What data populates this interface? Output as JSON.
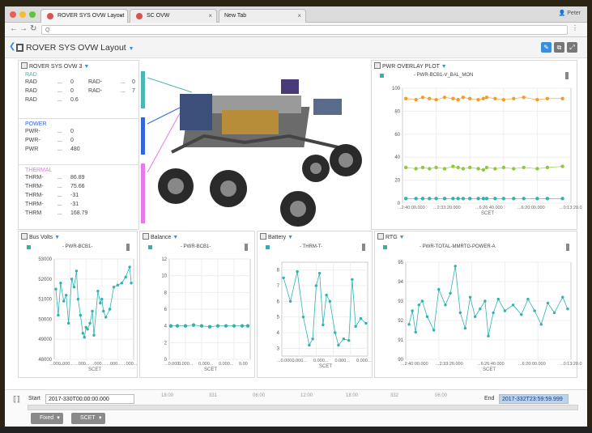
{
  "browser": {
    "tabs": [
      {
        "title": "ROVER SYS OVW Layout",
        "active": true
      },
      {
        "title": "SC OVW",
        "active": false
      },
      {
        "title": "New Tab",
        "active": false
      }
    ],
    "user": "Peter",
    "url": "Q"
  },
  "app": {
    "title": "ROVER SYS OVW Layout"
  },
  "overview_panel": {
    "title": "ROVER SYS OVW 3",
    "sections": [
      {
        "name": "RAD",
        "color": "#4cb7b2",
        "rows": [
          [
            "RAD",
            "...",
            "0",
            "RAD-",
            "...",
            "0"
          ],
          [
            "RAD",
            "...",
            "0",
            "RAD-",
            "...",
            "7"
          ],
          [
            "RAD",
            "...",
            "0.6",
            "",
            "",
            ""
          ]
        ]
      },
      {
        "name": "POWER",
        "color": "#3366dd",
        "rows": [
          [
            "PWR-",
            "...",
            "0"
          ],
          [
            "PWR-",
            "...",
            "0"
          ],
          [
            "PWR",
            "...",
            "480"
          ]
        ]
      },
      {
        "name": "THERMAL",
        "color": "#e879e8",
        "rows": [
          [
            "THRM-",
            "...",
            "86.89"
          ],
          [
            "THRM-",
            "...",
            "75.66"
          ],
          [
            "THRM-",
            "...",
            "-31"
          ],
          [
            "THRM-",
            "...",
            "-31"
          ],
          [
            "THRM",
            "...",
            "168.79"
          ]
        ]
      }
    ]
  },
  "charts": {
    "pwr": {
      "title": "PWR OVERLAY PLOT",
      "legend": "- PWR-BCB1-V_BAL_MON",
      "xlabel": "SCET",
      "xticks": [
        "...2:40:00.000",
        "...2:33:20.000",
        "...6:26:40.000",
        "...6:20:00.000",
        "...0:13:20.0"
      ]
    },
    "bus": {
      "title": "Bus Volts",
      "legend": "- PWR-BCB1-",
      "xlabel": "SCET",
      "xticks": [
        "...000...",
        "...000...",
        "...000...",
        "...000...",
        "...000...",
        "...000..."
      ]
    },
    "balance": {
      "title": "Balance",
      "legend": "- PWR-BCB1-",
      "xlabel": "SCET",
      "xticks": [
        "...0.000...",
        "0.000...",
        "0.000...",
        "0.000...",
        "0.00"
      ]
    },
    "battery": {
      "title": "Battery",
      "legend": "- THRM-T-",
      "xlabel": "SCET",
      "xticks": [
        "...0.000...",
        "0.000...",
        "0.000...",
        "0.000...",
        "0.000..."
      ]
    },
    "rtg": {
      "title": "RTG",
      "legend": "- PWR-TOTAL-MMRTG-POWER-A",
      "xlabel": "SCET",
      "xticks": [
        "...2:40:00.000",
        "...2:33:20.000",
        "...6:26:40.000",
        "...6:20:00.000",
        "...0:13:20.0"
      ]
    }
  },
  "chart_data": [
    {
      "type": "scatter",
      "title": "PWR OVERLAY PLOT",
      "ylim": [
        0,
        100
      ],
      "yticks": [
        0,
        20,
        40,
        60,
        80,
        100
      ],
      "series": [
        {
          "color": "#f39c2b",
          "x": [
            0.02,
            0.08,
            0.12,
            0.16,
            0.2,
            0.25,
            0.3,
            0.33,
            0.36,
            0.4,
            0.45,
            0.48,
            0.5,
            0.55,
            0.6,
            0.66,
            0.72,
            0.8,
            0.86,
            0.95
          ],
          "y": [
            91,
            90,
            92,
            91,
            90,
            92,
            91,
            90,
            92,
            91,
            90,
            91,
            92,
            91,
            90,
            91,
            92,
            90,
            91,
            91
          ]
        },
        {
          "color": "#8fc93a",
          "x": [
            0.02,
            0.08,
            0.12,
            0.16,
            0.2,
            0.25,
            0.3,
            0.33,
            0.36,
            0.4,
            0.45,
            0.48,
            0.5,
            0.55,
            0.6,
            0.66,
            0.72,
            0.8,
            0.86,
            0.95
          ],
          "y": [
            31,
            30,
            31,
            30,
            31,
            30,
            32,
            31,
            30,
            31,
            30,
            29,
            31,
            30,
            31,
            30,
            31,
            30,
            31,
            32
          ]
        },
        {
          "color": "#30b3b0",
          "x": [
            0.02,
            0.08,
            0.12,
            0.16,
            0.2,
            0.25,
            0.3,
            0.33,
            0.36,
            0.4,
            0.45,
            0.48,
            0.5,
            0.55,
            0.6,
            0.66,
            0.72,
            0.8,
            0.86,
            0.95
          ],
          "y": [
            4,
            4,
            4,
            4,
            4,
            4,
            4,
            4,
            4,
            4,
            4,
            4,
            4,
            4,
            4,
            4,
            4,
            4,
            4,
            4
          ]
        }
      ]
    },
    {
      "type": "line",
      "title": "Bus Volts",
      "ylim": [
        48000,
        53000
      ],
      "yticks": [
        48000,
        49000,
        50000,
        51000,
        52000,
        53000
      ],
      "series": [
        {
          "color": "#30b3b0",
          "x": [
            0.02,
            0.05,
            0.08,
            0.12,
            0.15,
            0.18,
            0.22,
            0.25,
            0.28,
            0.3,
            0.33,
            0.36,
            0.38,
            0.4,
            0.42,
            0.45,
            0.48,
            0.5,
            0.55,
            0.58,
            0.6,
            0.62,
            0.65,
            0.7,
            0.75,
            0.8,
            0.85,
            0.9,
            0.95,
            0.97
          ],
          "y": [
            51500,
            50200,
            51800,
            50900,
            51200,
            49800,
            52000,
            51600,
            52400,
            51000,
            50200,
            49300,
            49100,
            49600,
            49500,
            49800,
            50400,
            49200,
            51400,
            50800,
            51000,
            50400,
            50100,
            50500,
            51600,
            51700,
            51800,
            52100,
            52600,
            51800
          ]
        }
      ]
    },
    {
      "type": "line",
      "title": "Balance",
      "ylim": [
        0,
        12
      ],
      "yticks": [
        0,
        2,
        4,
        6,
        8,
        10,
        12
      ],
      "series": [
        {
          "color": "#30b3b0",
          "x": [
            0.02,
            0.1,
            0.2,
            0.3,
            0.4,
            0.5,
            0.6,
            0.7,
            0.8,
            0.9,
            0.97
          ],
          "y": [
            4,
            4,
            4,
            4.1,
            4,
            3.9,
            4,
            4,
            4,
            4,
            4
          ]
        }
      ]
    },
    {
      "type": "line",
      "title": "Battery",
      "ylim": [
        2.5,
        8.5
      ],
      "yticks": [
        3,
        4,
        5,
        6,
        7,
        8
      ],
      "series": [
        {
          "color": "#30b3b0",
          "x": [
            0.02,
            0.1,
            0.18,
            0.25,
            0.32,
            0.36,
            0.4,
            0.44,
            0.48,
            0.52,
            0.56,
            0.62,
            0.66,
            0.72,
            0.78,
            0.82,
            0.86,
            0.92,
            0.98
          ],
          "y": [
            7.5,
            6,
            7.9,
            5,
            3.2,
            3.6,
            7,
            7.8,
            4.5,
            6.4,
            6,
            4,
            3.2,
            3.6,
            3.5,
            7.4,
            4.4,
            4.9,
            4.6
          ]
        }
      ]
    },
    {
      "type": "line",
      "title": "RTG",
      "ylim": [
        90,
        95
      ],
      "yticks": [
        90,
        91,
        92,
        93,
        94,
        95
      ],
      "series": [
        {
          "color": "#30b3b0",
          "x": [
            0.02,
            0.04,
            0.06,
            0.08,
            0.1,
            0.13,
            0.17,
            0.2,
            0.24,
            0.27,
            0.3,
            0.33,
            0.36,
            0.39,
            0.42,
            0.45,
            0.48,
            0.5,
            0.53,
            0.56,
            0.6,
            0.65,
            0.7,
            0.74,
            0.78,
            0.82,
            0.86,
            0.9,
            0.95,
            0.98
          ],
          "y": [
            91.8,
            92.5,
            91.4,
            92.8,
            93,
            92.2,
            91.5,
            93.6,
            92.8,
            93.4,
            94.8,
            92.4,
            91.6,
            93.2,
            92.2,
            92.6,
            93,
            91.2,
            92.4,
            93.1,
            92.5,
            92.8,
            92.3,
            93.1,
            92.5,
            91.8,
            92.9,
            92.4,
            93.2,
            92.6
          ]
        }
      ]
    }
  ],
  "timeline": {
    "start_label": "Start",
    "start_value": "2017-330T00:00:00.000",
    "end_label": "End",
    "end_value": "2017-332T23:59:59.999",
    "ticks": [
      "18:00",
      "331",
      "06:00",
      "12:00",
      "18:00",
      "332",
      "06:00"
    ],
    "fixed_label": "Fixed",
    "scet_label": "SCET"
  },
  "colors": {
    "accent": "#3a8fd8",
    "series": "#30b3b0"
  }
}
